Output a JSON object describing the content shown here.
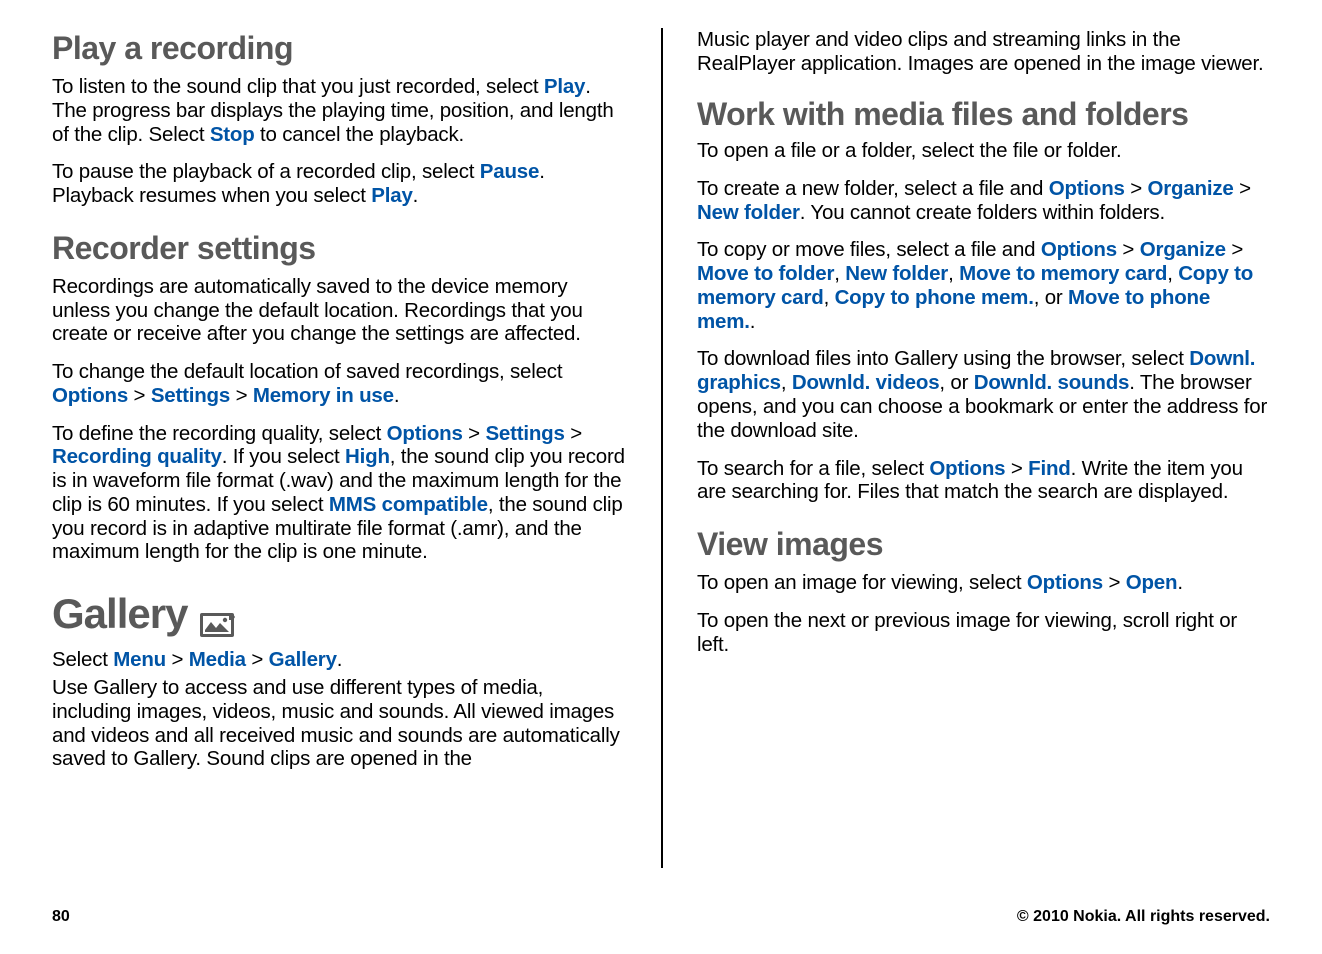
{
  "left": {
    "h_play": "Play a recording",
    "p1a": "To listen to the sound clip that you just recorded, select ",
    "play": "Play",
    "p1b": ". The progress bar displays the playing time, position, and length of the clip. Select ",
    "stop": "Stop",
    "p1c": " to cancel the playback.",
    "p2a": "To pause the playback of a recorded clip, select ",
    "pause": "Pause",
    "p2b": ". Playback resumes when you select ",
    "play2": "Play",
    "p2c": ".",
    "h_rec": "Recorder settings",
    "p3": "Recordings are automatically saved to the device memory unless you change the default location. Recordings that you create or receive after you change the settings are affected.",
    "p4a": "To change the default location of saved recordings, select ",
    "options1": "Options",
    "settings1": "Settings",
    "memuse": "Memory in use",
    "p4end": ".",
    "p5a": "To define the recording quality, select ",
    "options2": "Options",
    "settings2": "Settings",
    "recq": "Recording quality",
    "p5b": ". If you select ",
    "high": "High",
    "p5c": ", the sound clip you record is in waveform file format (.wav) and the maximum length for the clip is 60 minutes. If you select ",
    "mms": "MMS compatible",
    "p5d": ", the sound clip you record is in adaptive multirate file format (.amr), and the maximum length for the clip is one minute.",
    "h_gallery": "Gallery",
    "p6a": "Select ",
    "menu": "Menu",
    "media": "Media",
    "gallery": "Gallery",
    "p6end": ".",
    "p7": "Use Gallery to access and use different types of media, including images, videos, music and sounds. All viewed images and videos and all received music and sounds are automatically saved to Gallery. Sound clips are opened in the"
  },
  "right": {
    "p1": "Music player and video clips and streaming links in the RealPlayer application. Images are opened in the image viewer.",
    "h_work": "Work with media files and folders",
    "p2": "To open a file or a folder, select the file or folder.",
    "p3a": "To create a new folder, select a file and ",
    "options1": "Options",
    "organize1": "Organize",
    "newfolder1": "New folder",
    "p3b": ". You cannot create folders within folders.",
    "p4a": "To copy or move files, select a file and ",
    "options2": "Options",
    "organize2": "Organize",
    "movef": "Move to folder",
    "newfolder2": "New folder",
    "movemem": "Move to memory card",
    "copymem": "Copy to memory card",
    "copyphone": "Copy to phone mem.",
    "or1": ", or ",
    "movephone": "Move to phone mem.",
    "p4end": ".",
    "p5a": "To download files into Gallery using the browser, select ",
    "dlgraphics": "Downl. graphics",
    "dlvideos": "Downld. videos",
    "or2": ", or ",
    "dlsounds": "Downld. sounds",
    "p5b": ". The browser opens, and you can choose a bookmark or enter the address for the download site.",
    "p6a": "To search for a file, select ",
    "options3": "Options",
    "find": "Find",
    "p6b": ". Write the item you are searching for. Files that match the search are displayed.",
    "h_view": "View images",
    "p7a": "To open an image for viewing, select ",
    "options4": "Options",
    "open": "Open",
    "p7end": ".",
    "p8": "To open the next or previous image for viewing, scroll right or left."
  },
  "footer": {
    "page": "80",
    "copy": "© 2010 Nokia. All rights reserved."
  },
  "gt": " > "
}
